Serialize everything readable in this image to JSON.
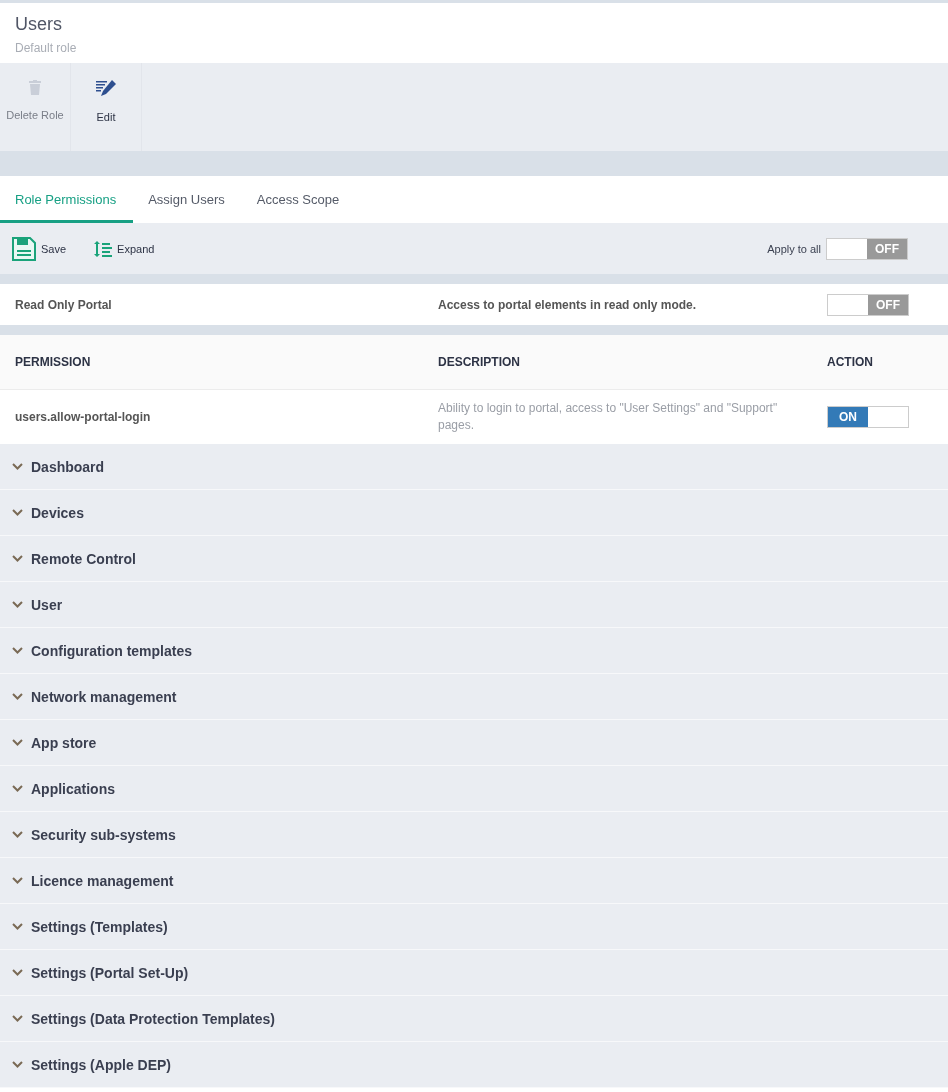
{
  "header": {
    "title": "Users",
    "subtitle": "Default role"
  },
  "toolbar": [
    {
      "kind": "delete",
      "label": "Delete Role",
      "disabled": true
    },
    {
      "kind": "edit",
      "label": "Edit",
      "disabled": false
    }
  ],
  "tabs": [
    {
      "label": "Role Permissions",
      "selected": true
    },
    {
      "label": "Assign Users",
      "selected": false
    },
    {
      "label": "Access Scope",
      "selected": false
    }
  ],
  "actions": [
    {
      "kind": "save",
      "label": "Save"
    },
    {
      "kind": "expand",
      "label": "Expand"
    }
  ],
  "apply_to_all": {
    "label": "Apply to all",
    "on": false,
    "text": "OFF"
  },
  "read_only": {
    "name": "Read Only Portal",
    "description": "Access to portal elements in read only mode.",
    "on": false,
    "text": "OFF"
  },
  "table": {
    "columns": [
      "PERMISSION",
      "DESCRIPTION",
      "ACTION"
    ],
    "rows": [
      {
        "permission": "users.allow-portal-login",
        "description": "Ability to login to portal, access to \"User Settings\" and \"Support\" pages.",
        "on": true,
        "text": "ON"
      }
    ]
  },
  "sections": [
    {
      "label": "Dashboard",
      "expanded": false
    },
    {
      "label": "Devices",
      "expanded": false
    },
    {
      "label": "Remote Control",
      "expanded": false
    },
    {
      "label": "User",
      "expanded": false
    },
    {
      "label": "Configuration templates",
      "expanded": false
    },
    {
      "label": "Network management",
      "expanded": false
    },
    {
      "label": "App store",
      "expanded": false
    },
    {
      "label": "Applications",
      "expanded": false
    },
    {
      "label": "Security sub-systems",
      "expanded": false
    },
    {
      "label": "Licence management",
      "expanded": false
    },
    {
      "label": "Settings (Templates)",
      "expanded": false
    },
    {
      "label": "Settings (Portal Set-Up)",
      "expanded": false
    },
    {
      "label": "Settings (Data Protection Templates)",
      "expanded": false
    },
    {
      "label": "Settings (Apple DEP)",
      "expanded": false
    }
  ]
}
